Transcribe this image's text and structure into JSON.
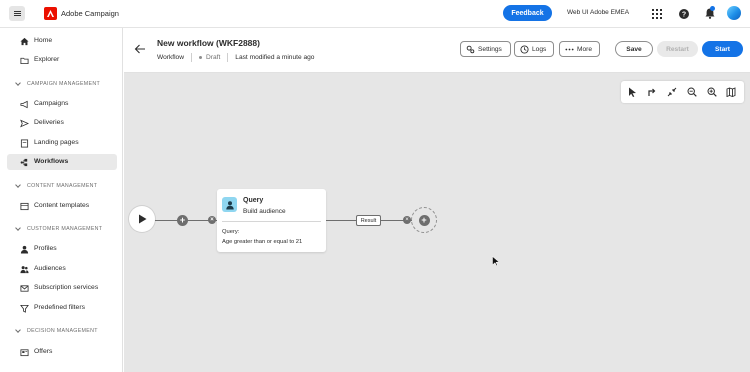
{
  "topbar": {
    "app_name": "Adobe Campaign",
    "feedback_label": "Feedback",
    "org_name": "Web UI Adobe EMEA",
    "accent_color": "#1473e6"
  },
  "sidebar": {
    "items": [
      {
        "label": "Home",
        "icon": "home-icon"
      },
      {
        "label": "Explorer",
        "icon": "folder-icon"
      },
      {
        "label": "Campaigns",
        "icon": "megaphone-icon"
      },
      {
        "label": "Deliveries",
        "icon": "send-icon"
      },
      {
        "label": "Landing pages",
        "icon": "page-icon"
      },
      {
        "label": "Workflows",
        "icon": "workflow-icon",
        "active": true
      },
      {
        "label": "Content templates",
        "icon": "template-icon"
      },
      {
        "label": "Profiles",
        "icon": "user-icon"
      },
      {
        "label": "Audiences",
        "icon": "users-icon"
      },
      {
        "label": "Subscription services",
        "icon": "subscription-icon"
      },
      {
        "label": "Predefined filters",
        "icon": "filter-icon"
      },
      {
        "label": "Offers",
        "icon": "offer-icon"
      }
    ],
    "sections": {
      "campaign": "CAMPAIGN MANAGEMENT",
      "content": "CONTENT MANAGEMENT",
      "customer": "CUSTOMER MANAGEMENT",
      "decision": "DECISION MANAGEMENT"
    }
  },
  "header": {
    "title": "New workflow (WKF2888)",
    "type": "Workflow",
    "status": "Draft",
    "modified": "Last modified a minute ago",
    "settings_label": "Settings",
    "logs_label": "Logs",
    "more_label": "More",
    "save_label": "Save",
    "restart_label": "Restart",
    "start_label": "Start"
  },
  "canvas": {
    "query_card": {
      "title": "Query",
      "subtitle": "Build audience",
      "query_label": "Query:",
      "query_value": "Age greater than or equal to 21"
    },
    "result_label": "Result"
  }
}
